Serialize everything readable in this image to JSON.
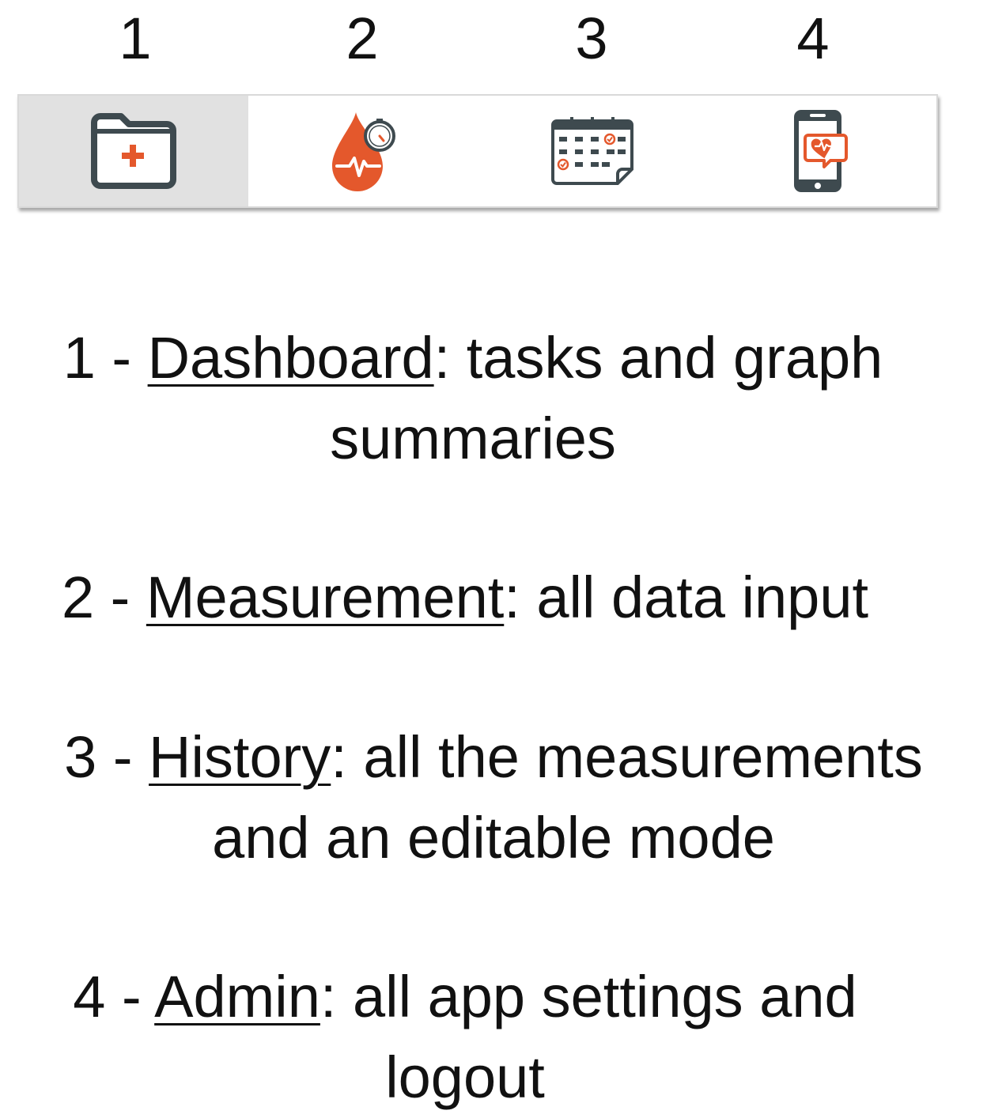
{
  "numbers": [
    "1",
    "2",
    "3",
    "4"
  ],
  "tabs": [
    {
      "icon": "medical-folder-icon",
      "active": true
    },
    {
      "icon": "blood-drop-gauge-icon",
      "active": false
    },
    {
      "icon": "calendar-checklist-icon",
      "active": false
    },
    {
      "icon": "phone-heart-chat-icon",
      "active": false
    }
  ],
  "colors": {
    "icon_dark": "#3e4a4f",
    "icon_accent": "#e4582c",
    "active_tab_bg": "#e1e1e1"
  },
  "descriptions": [
    {
      "prefix": "1 - ",
      "name": "Dashboard",
      "line1": ": tasks and graph",
      "line2": "summaries"
    },
    {
      "prefix": "2 - ",
      "name": "Measurement",
      "line1": ": all data input",
      "line2": ""
    },
    {
      "prefix": "3 - ",
      "name": "History",
      "line1": ": all the measurements",
      "line2": "and an editable mode"
    },
    {
      "prefix": "4 - ",
      "name": "Admin",
      "line1": ": all app settings and",
      "line2": "logout"
    }
  ]
}
